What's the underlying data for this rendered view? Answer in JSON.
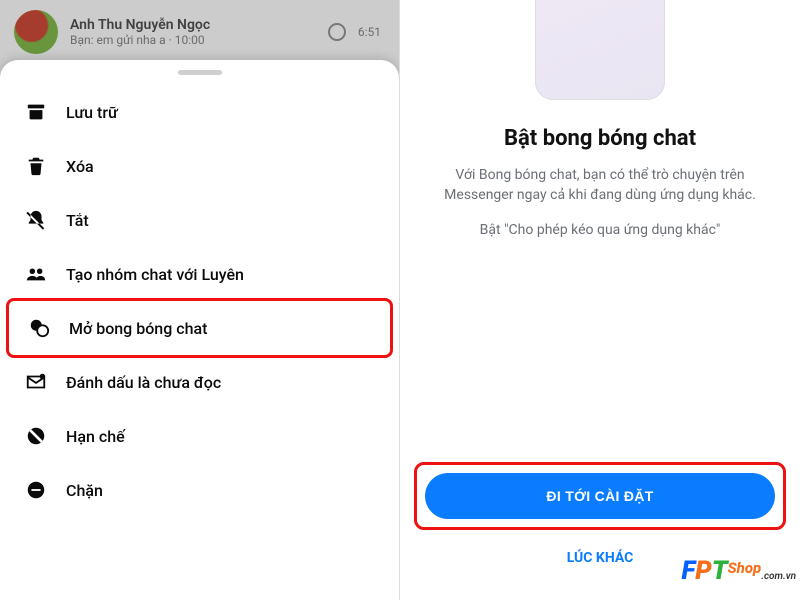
{
  "left": {
    "chat_preview": {
      "name": "Anh Thu Nguyễn Ngọc",
      "preview": "Bạn: em gửi nha a · 10:00",
      "time": "6:51"
    },
    "menu": {
      "archive": "Lưu trữ",
      "delete": "Xóa",
      "mute": "Tắt",
      "create_group": "Tạo nhóm chat với Luyên",
      "open_bubble": "Mở bong bóng chat",
      "mark_unread": "Đánh dấu là chưa đọc",
      "restrict": "Hạn chế",
      "block": "Chặn"
    }
  },
  "right": {
    "title": "Bật bong bóng chat",
    "description": "Với Bong bóng chat, bạn có thể trò chuyện trên Messenger ngay cả khi đang dùng ứng dụng khác.",
    "instruction": "Bật \"Cho phép kéo qua ứng dụng khác\"",
    "cta": "ĐI TỚI CÀI ĐẶT",
    "later": "LÚC KHÁC"
  },
  "watermark": {
    "brand": "FPT",
    "shop": "Shop",
    "domain": ".com.vn"
  }
}
